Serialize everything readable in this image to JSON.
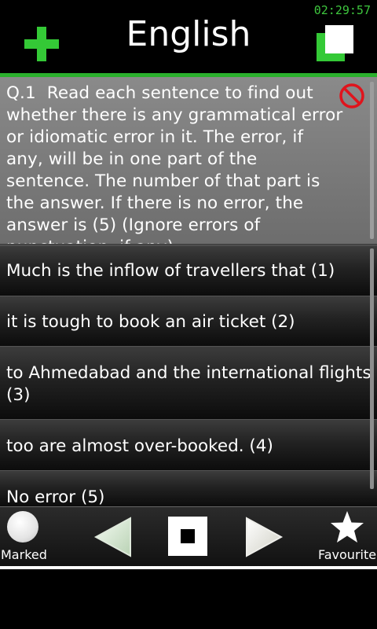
{
  "status_bar": {
    "time": "02:29:57"
  },
  "header": {
    "title": "English",
    "add_icon": "plus-icon",
    "copy_icon": "copy-icon",
    "accent": "#34c936"
  },
  "question": {
    "number": "Q.1",
    "text": "Read each sentence to find out whether there is any grammatical error or idiomatic error in it. The error, if any, will be in one part of the sentence. The number of that part is the answer. If there is no error, the answer is (5) (Ignore errors of punctuation, if any).",
    "report_icon": "no-entry-icon"
  },
  "options": [
    {
      "text": "Much is the inflow of travellers that (1)"
    },
    {
      "text": "it is tough to book an air ticket (2)"
    },
    {
      "text": "to Ahmedabad and the international flights (3)"
    },
    {
      "text": "too are almost over-booked. (4)"
    },
    {
      "text": "No error (5)"
    }
  ],
  "toolbar": {
    "marked_label": "Marked",
    "favourite_label": "Favourite",
    "prev_icon": "left-arrow-icon",
    "stop_icon": "stop-icon",
    "next_icon": "right-arrow-icon"
  }
}
